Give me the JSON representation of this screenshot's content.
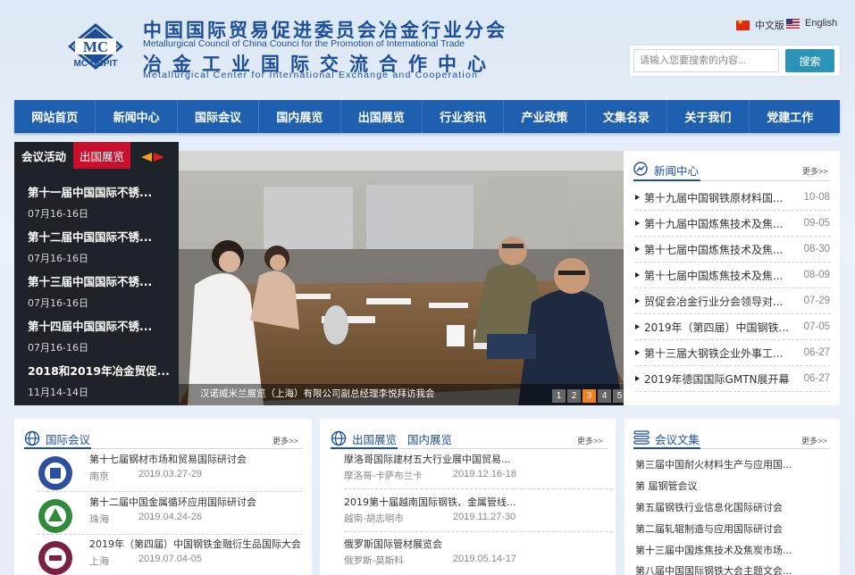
{
  "header": {
    "logo_text": "MC",
    "logo_caption": "MC-CCPIT",
    "title_cn": "中国国际贸易促进委员会冶金行业分会",
    "title_en": "Metallurgical Council of China Counci  for the Promotion of International Trade",
    "title_cn2": "冶金工业国际交流合作中心",
    "title_en2": "Metallurgical Center for International Exchange and Cooperation",
    "lang_cn": "中文版",
    "lang_en": "English",
    "search_placeholder": "请输入您要搜索的内容...",
    "search_button": "搜索"
  },
  "nav": [
    "网站首页",
    "新闻中心",
    "国际会议",
    "国内展览",
    "出国展览",
    "行业资讯",
    "产业政策",
    "文集名录",
    "关于我们",
    "党建工作"
  ],
  "activity": {
    "tab_active": "会议活动",
    "tab_other": "出国展览",
    "items": [
      {
        "title": "第十一届中国国际不锈...",
        "date": "07月16-16日"
      },
      {
        "title": "第十二届中国国际不锈...",
        "date": "07月16-16日"
      },
      {
        "title": "第十三届中国国际不锈...",
        "date": "07月16-16日"
      },
      {
        "title": "第十四届中国国际不锈...",
        "date": "07月16-16日"
      },
      {
        "title": "2018和2019年冶金贸促...",
        "date": "11月14-14日"
      }
    ]
  },
  "banner": {
    "caption": "汉诺威米兰展览（上海）有限公司副总经理李悦拜访我会",
    "dots": [
      "1",
      "2",
      "3",
      "4",
      "5"
    ],
    "active_dot": 3
  },
  "news": {
    "title": "新闻中心",
    "more": "更多>>",
    "items": [
      {
        "title": "第十九届中国钢铁原材料国...",
        "date": "10-08"
      },
      {
        "title": "第十九届中国炼焦技术及焦...",
        "date": "09-05"
      },
      {
        "title": "第十七届中国炼焦技术及焦...",
        "date": "08-30"
      },
      {
        "title": "第十七届中国炼焦技术及焦...",
        "date": "08-09"
      },
      {
        "title": "贸促会冶金行业分会领导对...",
        "date": "07-29"
      },
      {
        "title": "2019年（第四届）中国钢铁...",
        "date": "07-05"
      },
      {
        "title": "第十三届大钢铁企业外事工...",
        "date": "06-27"
      },
      {
        "title": "2019年德国国际GMTN展开幕",
        "date": "06-27"
      }
    ]
  },
  "conference": {
    "title": "国际会议",
    "more": "更多>>",
    "items": [
      {
        "title": "第十七届钢材市场和贸易国际研讨会",
        "city": "南京",
        "date": "2019.03.27-29"
      },
      {
        "title": "第十二届中国金属循环应用国际研讨会",
        "city": "珠海",
        "date": "2019.04.24-26"
      },
      {
        "title": "2019年（第四届）中国钢铁金融衍生品国际大会",
        "city": "上海",
        "date": "2019.07.04-05"
      }
    ]
  },
  "exhibition": {
    "title": "出国展览",
    "title2": "国内展览",
    "more": "更多>>",
    "items": [
      {
        "title": "摩洛哥国际建材五大行业展中国贸易...",
        "city": "摩洛哥-卡萨布兰卡",
        "date": "2019.12.16-18"
      },
      {
        "title": "2019第十届越南国际钢铁、金属管线...",
        "city": "越南-胡志明市",
        "date": "2019.11.27-30"
      },
      {
        "title": "俄罗斯国际管材展览会",
        "city": "俄罗斯-莫斯科",
        "date": "2019.05.14-17"
      }
    ]
  },
  "papers": {
    "title": "会议文集",
    "more": "更多>>",
    "items": [
      "第三届中国耐火材料生产与应用国...",
      "第 届钢管会议",
      "第五届钢铁行业信息化国际研讨会",
      "第二届轧辊制造与应用国际研讨会",
      "第十三届中国炼焦技术及焦炭市场...",
      "第八届中国国际钢铁大会主题文会..."
    ]
  },
  "colors": {
    "brand_blue": "#1c4e9c",
    "nav_blue": "#1f5faf",
    "accent_red": "#c8102e",
    "active_dot": "#f08020"
  }
}
